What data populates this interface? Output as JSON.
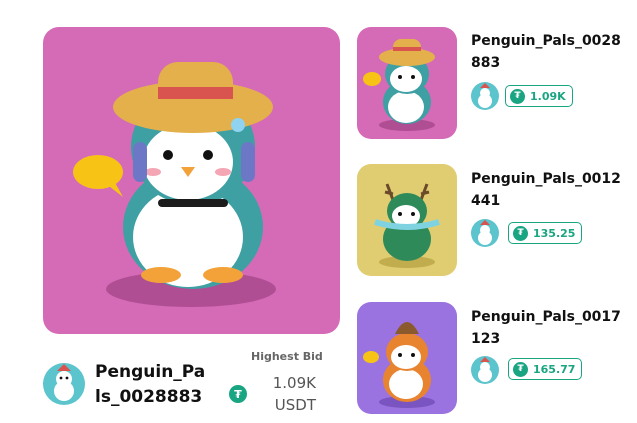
{
  "featured": {
    "name": "Penguin_Pals_0028883",
    "bid_label": "Highest Bid",
    "bid_value": "1.09K",
    "bid_currency": "USDT",
    "bg": "#d56ab7"
  },
  "cards": [
    {
      "name": "Penguin_Pals_0028883",
      "price": "1.09K",
      "bg": "#d56ab7"
    },
    {
      "name": "Penguin_Pals_0012441",
      "price": "135.25",
      "bg": "#e0cd72"
    },
    {
      "name": "Penguin_Pals_0017123",
      "price": "165.77",
      "bg": "#9b73e0"
    }
  ],
  "icons": {
    "currency": "tether-icon",
    "avatar": "penguin-avatar-icon"
  },
  "colors": {
    "accent": "#1aa582"
  }
}
